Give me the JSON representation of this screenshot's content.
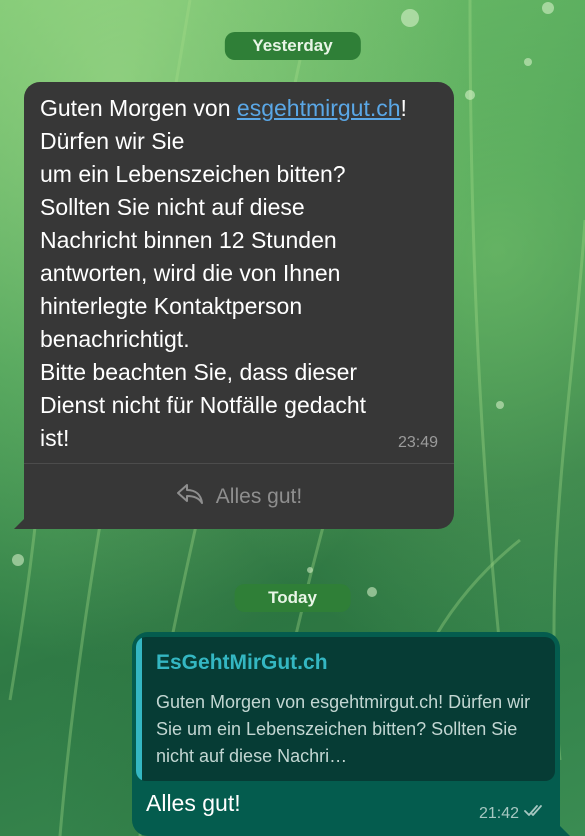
{
  "dates": {
    "yesterday": "Yesterday",
    "today": "Today"
  },
  "incoming": {
    "text_before_link": "Guten Morgen von ",
    "link": "esgehtmirgut.ch",
    "text_after_link": "! Dürfen wir Sie\num ein Lebenszeichen bitten?\nSollten Sie nicht auf diese\nNachricht binnen 12 Stunden\nantworten, wird die von Ihnen\nhinterlegte Kontaktperson\nbenachrichtigt.\nBitte beachten Sie, dass dieser\nDienst nicht für Notfälle gedacht\nist!",
    "time": "23:49",
    "reply_button": "Alles gut!",
    "reply_icon": "reply-icon"
  },
  "outgoing": {
    "quote_title": "EsGehtMirGut.ch",
    "quote_text": "Guten Morgen von esgehtmirgut.ch! Dürfen wir Sie um ein Lebenszeichen bitten? Sollten Sie nicht auf diese Nachri…",
    "text": "Alles gut!",
    "time": "21:42",
    "status_icon": "double-check-icon"
  },
  "colors": {
    "date_chip": "#2f7f37",
    "incoming_bubble": "#373737",
    "outgoing_bubble": "#045c4e",
    "link": "#5aa7e6",
    "quote_accent": "#34b7c2"
  }
}
